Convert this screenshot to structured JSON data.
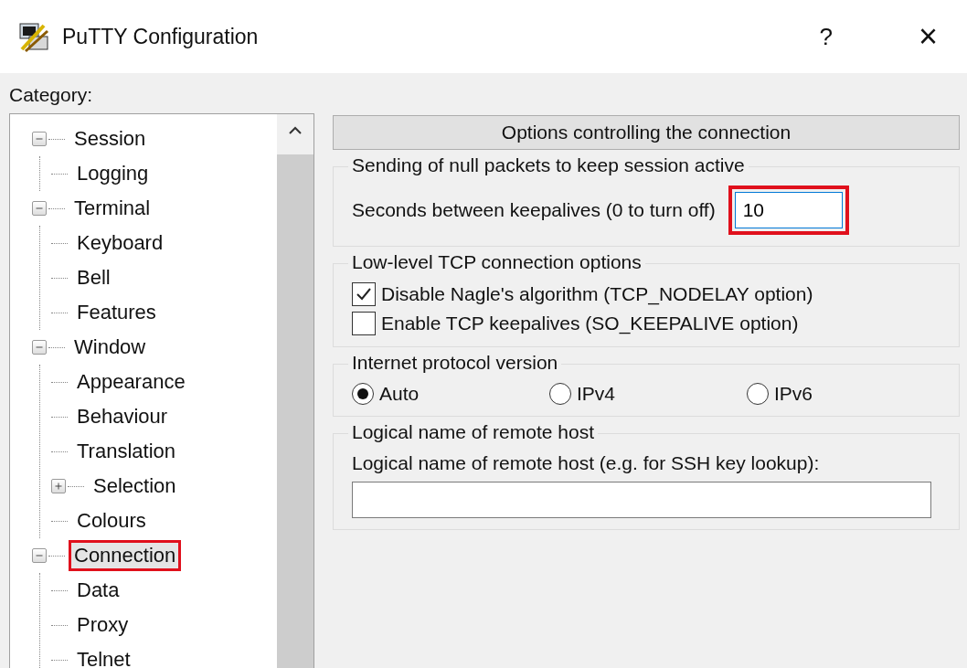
{
  "window": {
    "title": "PuTTY Configuration",
    "help": "?",
    "close": "×"
  },
  "category_label": "Category:",
  "tree": [
    {
      "label": "Session",
      "expanded": true,
      "selected": false,
      "highlighted": false,
      "children": [
        {
          "label": "Logging",
          "selected": false,
          "highlighted": false
        }
      ]
    },
    {
      "label": "Terminal",
      "expanded": true,
      "selected": false,
      "highlighted": false,
      "children": [
        {
          "label": "Keyboard",
          "selected": false,
          "highlighted": false
        },
        {
          "label": "Bell",
          "selected": false,
          "highlighted": false
        },
        {
          "label": "Features",
          "selected": false,
          "highlighted": false
        }
      ]
    },
    {
      "label": "Window",
      "expanded": true,
      "selected": false,
      "highlighted": false,
      "children": [
        {
          "label": "Appearance",
          "selected": false,
          "highlighted": false
        },
        {
          "label": "Behaviour",
          "selected": false,
          "highlighted": false
        },
        {
          "label": "Translation",
          "selected": false,
          "highlighted": false
        },
        {
          "label": "Selection",
          "expanded": false,
          "selected": false,
          "highlighted": false
        },
        {
          "label": "Colours",
          "selected": false,
          "highlighted": false
        }
      ]
    },
    {
      "label": "Connection",
      "expanded": true,
      "selected": true,
      "highlighted": true,
      "children": [
        {
          "label": "Data",
          "selected": false,
          "highlighted": false
        },
        {
          "label": "Proxy",
          "selected": false,
          "highlighted": false
        },
        {
          "label": "Telnet",
          "selected": false,
          "highlighted": false
        }
      ]
    }
  ],
  "panel_header": "Options controlling the connection",
  "groups": [
    {
      "title": "Sending of null packets to keep session active",
      "items": [
        {
          "kind": "field",
          "label": "Seconds between keepalives (0 to turn off)",
          "value": "10",
          "highlighted": true
        }
      ]
    },
    {
      "title": "Low-level TCP connection options",
      "items": [
        {
          "kind": "checkbox",
          "label": "Disable Nagle's algorithm (TCP_NODELAY option)",
          "checked": true
        },
        {
          "kind": "checkbox",
          "label": "Enable TCP keepalives (SO_KEEPALIVE option)",
          "checked": false
        }
      ]
    },
    {
      "title": "Internet protocol version",
      "items": [
        {
          "kind": "radios",
          "options": [
            {
              "label": "Auto",
              "selected": true
            },
            {
              "label": "IPv4",
              "selected": false
            },
            {
              "label": "IPv6",
              "selected": false
            }
          ]
        }
      ]
    },
    {
      "title": "Logical name of remote host",
      "items": [
        {
          "kind": "wide-field",
          "label": "Logical name of remote host (e.g. for SSH key lookup):",
          "value": ""
        }
      ]
    }
  ]
}
